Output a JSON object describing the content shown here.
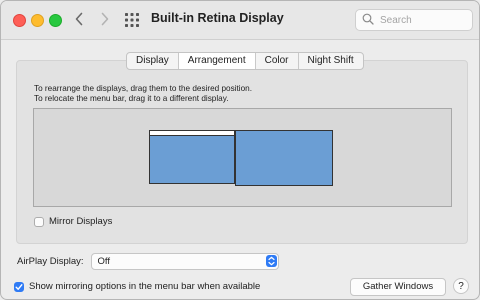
{
  "window": {
    "title": "Built-in Retina Display",
    "search_placeholder": "Search"
  },
  "tabs": [
    {
      "label": "Display",
      "active": false
    },
    {
      "label": "Arrangement",
      "active": true
    },
    {
      "label": "Color",
      "active": false
    },
    {
      "label": "Night Shift",
      "active": false
    }
  ],
  "arrangement": {
    "instruction_line1": "To rearrange the displays, drag them to the desired position.",
    "instruction_line2": "To relocate the menu bar, drag it to a different display.",
    "display_color": "#6b9ed4",
    "mirror_label": "Mirror Displays",
    "mirror_checked": false
  },
  "airplay": {
    "label": "AirPlay Display:",
    "value": "Off"
  },
  "footer": {
    "show_mirroring_label": "Show mirroring options in the menu bar when available",
    "show_mirroring_checked": true,
    "gather_label": "Gather Windows",
    "help_label": "?"
  },
  "colors": {
    "accent": "#2f7bf5",
    "close": "#fe5f57",
    "minimize": "#febc2e",
    "maximize": "#28c840"
  }
}
